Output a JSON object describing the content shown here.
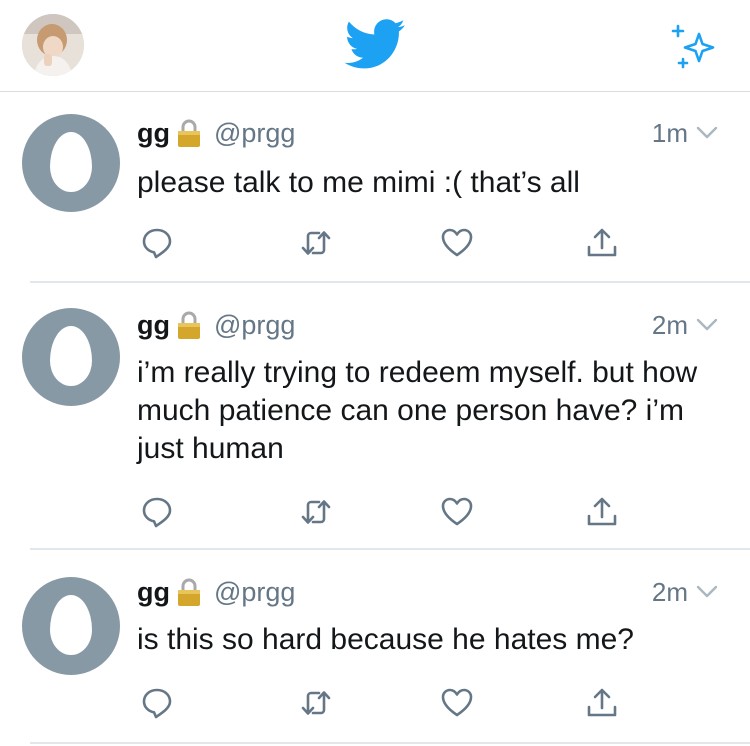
{
  "header": {
    "logo_icon": "twitter-bird-icon",
    "compose_icon": "sparkle-icon",
    "accent": "#1da1f2"
  },
  "tweets": [
    {
      "name": "gg",
      "handle": "@prgg",
      "time": "1m",
      "text": "please talk to me mimi :( that’s all",
      "protected": true,
      "actions": [
        "reply-icon",
        "retweet-icon",
        "like-icon",
        "share-icon"
      ]
    },
    {
      "name": "gg",
      "handle": "@prgg",
      "time": "2m",
      "text": "i’m really trying to redeem myself. but how much patience can one person have? i’m just human",
      "protected": true,
      "actions": [
        "reply-icon",
        "retweet-icon",
        "like-icon",
        "share-icon"
      ]
    },
    {
      "name": "gg",
      "handle": "@prgg",
      "time": "2m",
      "text": "is this so hard because he hates me?",
      "protected": true,
      "actions": [
        "reply-icon",
        "retweet-icon",
        "like-icon",
        "share-icon"
      ]
    }
  ]
}
